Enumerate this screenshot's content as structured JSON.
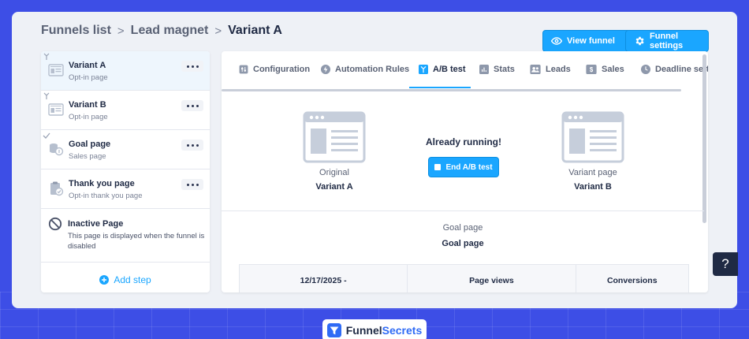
{
  "breadcrumb": {
    "items": [
      "Funnels list",
      "Lead magnet"
    ],
    "current": "Variant A",
    "separator": ">"
  },
  "header": {
    "view_funnel_label": "View funnel",
    "funnel_settings_label": "Funnel settings"
  },
  "sidebar": {
    "steps": [
      {
        "title": "Variant A",
        "subtitle": "Opt-in page",
        "active": true,
        "icon": "page-layout-icon"
      },
      {
        "title": "Variant B",
        "subtitle": "Opt-in page",
        "active": false,
        "icon": "page-layout-icon"
      },
      {
        "title": "Goal page",
        "subtitle": "Sales page",
        "active": false,
        "icon": "coins-icon"
      },
      {
        "title": "Thank you page",
        "subtitle": "Opt-in thank you page",
        "active": false,
        "icon": "clipboard-check-icon"
      }
    ],
    "inactive": {
      "title": "Inactive Page",
      "description": "This page is displayed when the funnel is disabled"
    },
    "add_step_label": "Add step"
  },
  "tabs": [
    {
      "label": "Configuration",
      "icon": "sliders-icon"
    },
    {
      "label": "Automation Rules",
      "icon": "bolt-icon"
    },
    {
      "label": "A/B test",
      "icon": "split-icon",
      "active": true
    },
    {
      "label": "Stats",
      "icon": "bar-chart-icon"
    },
    {
      "label": "Leads",
      "icon": "users-icon"
    },
    {
      "label": "Sales",
      "icon": "dollar-icon"
    },
    {
      "label": "Deadline setti",
      "icon": "clock-icon"
    }
  ],
  "ab_test": {
    "original": {
      "label": "Original",
      "name": "Variant A"
    },
    "variant": {
      "label": "Variant page",
      "name": "Variant B"
    },
    "status": "Already running!",
    "end_button_label": "End A/B test",
    "goal_label": "Goal page",
    "goal_value": "Goal page",
    "table_headers": [
      "12/17/2025 -",
      "Page views",
      "Conversions"
    ]
  },
  "help_label": "?",
  "brand": {
    "part1": "Funnel",
    "part2": "Secrets"
  },
  "colors": {
    "accent": "#1aa6ff",
    "background": "#3d4ee6",
    "text": "#1f2a44"
  }
}
